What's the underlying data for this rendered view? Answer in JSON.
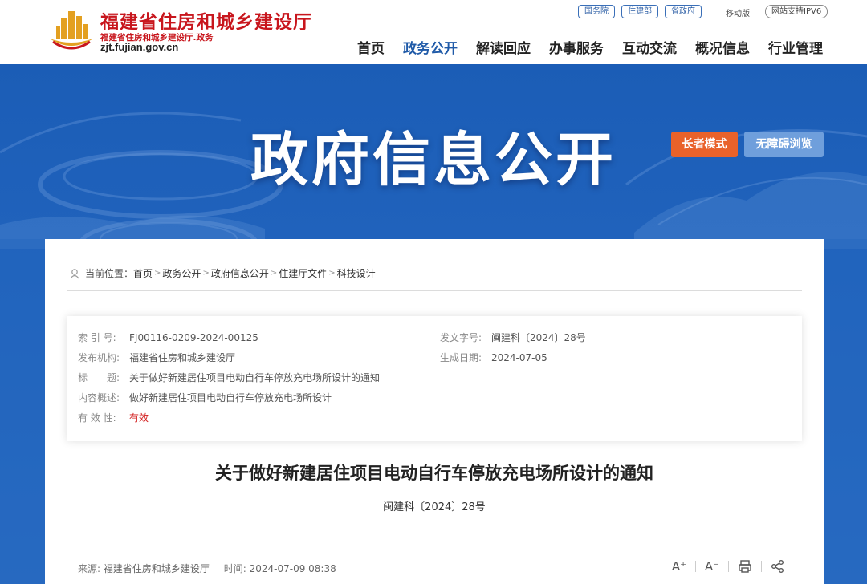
{
  "header": {
    "site_name": "福建省住房和城乡建设厅",
    "site_subtitle": "福建省住房和城乡建设厅.政务",
    "site_domain": "zjt.fujian.gov.cn",
    "top_links": [
      "国务院",
      "住建部",
      "省政府"
    ],
    "mobile_label": "移动版",
    "ipv6_label": "网站支持IPV6",
    "nav": [
      "首页",
      "政务公开",
      "解读回应",
      "办事服务",
      "互动交流",
      "概况信息",
      "行业管理"
    ],
    "active_nav": "政务公开"
  },
  "banner": {
    "title": "政府信息公开",
    "elder_mode_label": "长者模式",
    "accessibility_label": "无障碍浏览"
  },
  "breadcrumb": {
    "prefix": "当前位置：",
    "items": [
      "首页",
      "政务公开",
      "政府信息公开",
      "住建厅文件",
      "科技设计"
    ],
    "separator": ">"
  },
  "meta": {
    "index_label": "索 引 号:",
    "index_value": "FJ00116-0209-2024-00125",
    "doc_number_label": "发文字号:",
    "doc_number_value": "闽建科〔2024〕28号",
    "publisher_label": "发布机构:",
    "publisher_value": "福建省住房和城乡建设厅",
    "date_label": "生成日期:",
    "date_value": "2024-07-05",
    "title_label": "标　　题:",
    "title_value": "关于做好新建居住项目电动自行车停放充电场所设计的通知",
    "summary_label": "内容概述:",
    "summary_value": "做好新建居住项目电动自行车停放充电场所设计",
    "validity_label": "有 效 性:",
    "validity_value": "有效"
  },
  "document": {
    "title": "关于做好新建居住项目电动自行车停放充电场所设计的通知",
    "number": "闽建科〔2024〕28号"
  },
  "footer_info": {
    "source_label": "来源:",
    "source_value": "福建省住房和城乡建设厅",
    "time_label": "时间:",
    "time_value": "2024-07-09 08:38",
    "font_larger": "A⁺",
    "font_smaller": "A⁻"
  },
  "colors": {
    "brand_red": "#c8161d",
    "nav_active": "#1f5aa8",
    "banner_blue": "#1b5db6",
    "elder_orange": "#e9622a",
    "access_blue": "#6f9fdc",
    "valid_red": "#d21b1b"
  },
  "icons": [
    "logo-emblem",
    "location-icon",
    "font-increase-icon",
    "font-decrease-icon",
    "print-icon",
    "share-icon"
  ]
}
